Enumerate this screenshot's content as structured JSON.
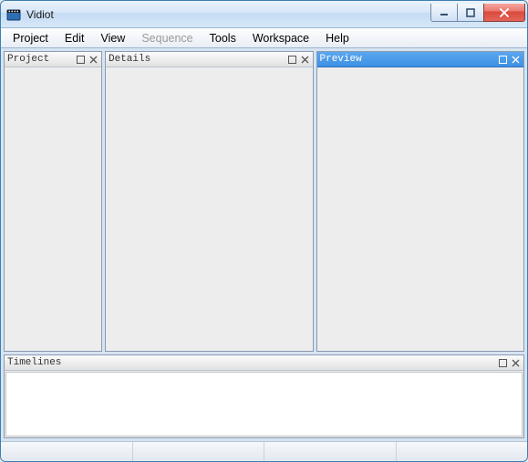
{
  "window": {
    "title": "Vidiot"
  },
  "menu": {
    "project": "Project",
    "edit": "Edit",
    "view": "View",
    "sequence": "Sequence",
    "tools": "Tools",
    "workspace": "Workspace",
    "help": "Help"
  },
  "panels": {
    "project": {
      "title": "Project",
      "active": false
    },
    "details": {
      "title": "Details",
      "active": false
    },
    "preview": {
      "title": "Preview",
      "active": true
    },
    "timelines": {
      "title": "Timelines",
      "active": false
    }
  }
}
